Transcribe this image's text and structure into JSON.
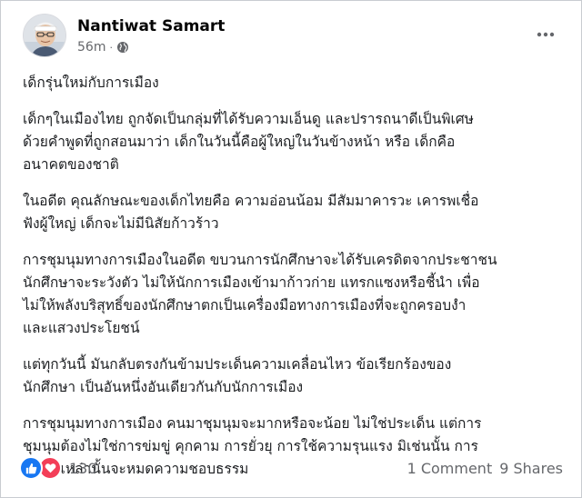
{
  "post": {
    "author": "Nantiwat Samart",
    "time": "56m",
    "separator": "·",
    "privacy_icon": "globe-icon",
    "more_icon": "more-dots-icon",
    "paragraphs": [
      [
        "เด็กรุ่นใหม่กับการเมือง"
      ],
      [
        "เด็กๆในเมืองไทย ถูกจัดเป็นกลุ่มที่ได้รับความเอ็นดู และปรารถนาดีเป็นพิเศษ",
        "ด้วยคำพูดที่ถูกสอนมาว่า เด็กในวันนี้คือผู้ใหญ่ในวันข้างหน้า หรือ เด็กคือ",
        "อนาคตของชาติ"
      ],
      [
        "ในอดีต คุณลักษณะของเด็กไทยคือ ความอ่อนน้อม มีสัมมาคารวะ เคารพเชื่อ",
        "ฟังผู้ใหญ่ เด็กจะไม่มีนิสัยก้าวร้าว"
      ],
      [
        "การชุมนุมทางการเมืองในอดีต ขบวนการนักศึกษาจะได้รับเครดิตจากประชาชน",
        "นักศึกษาจะระวังตัว ไม่ให้นักการเมืองเข้ามาก้าวก่าย แทรกแซงหรือชี้นำ เพื่อ",
        "ไม่ให้พลังบริสุทธิ์ของนักศึกษาตกเป็นเครื่องมือทางการเมืองที่จะถูกครอบงำ",
        "และแสวงประโยชน์"
      ],
      [
        "แต่ทุกวันนี้ มันกลับตรงกันข้ามประเด็นความเคลื่อนไหว ข้อเรียกร้องของ",
        "นักศึกษา เป็นอันหนึ่งอันเดียวกันกับนักการเมือง"
      ],
      [
        "การชุมนุมทางการเมือง คนมาชุมนุมจะมากหรือจะน้อย ไม่ใช่ประเด็น แต่การ",
        "ชุมนุมต้องไม่ใช่การข่มขู่ คุกคาม การยั่วยุ  การใช้ความรุนแรง มิเช่นนั้น การ",
        "ชุมนุมเหล่านั้นจะหมดความชอบธรรม"
      ]
    ],
    "reaction_count": "130",
    "comments": "1 Comment",
    "shares": "9 Shares",
    "colors": {
      "like": "#1877f2",
      "love": "#f33e58",
      "meta_text": "#65676b"
    }
  }
}
